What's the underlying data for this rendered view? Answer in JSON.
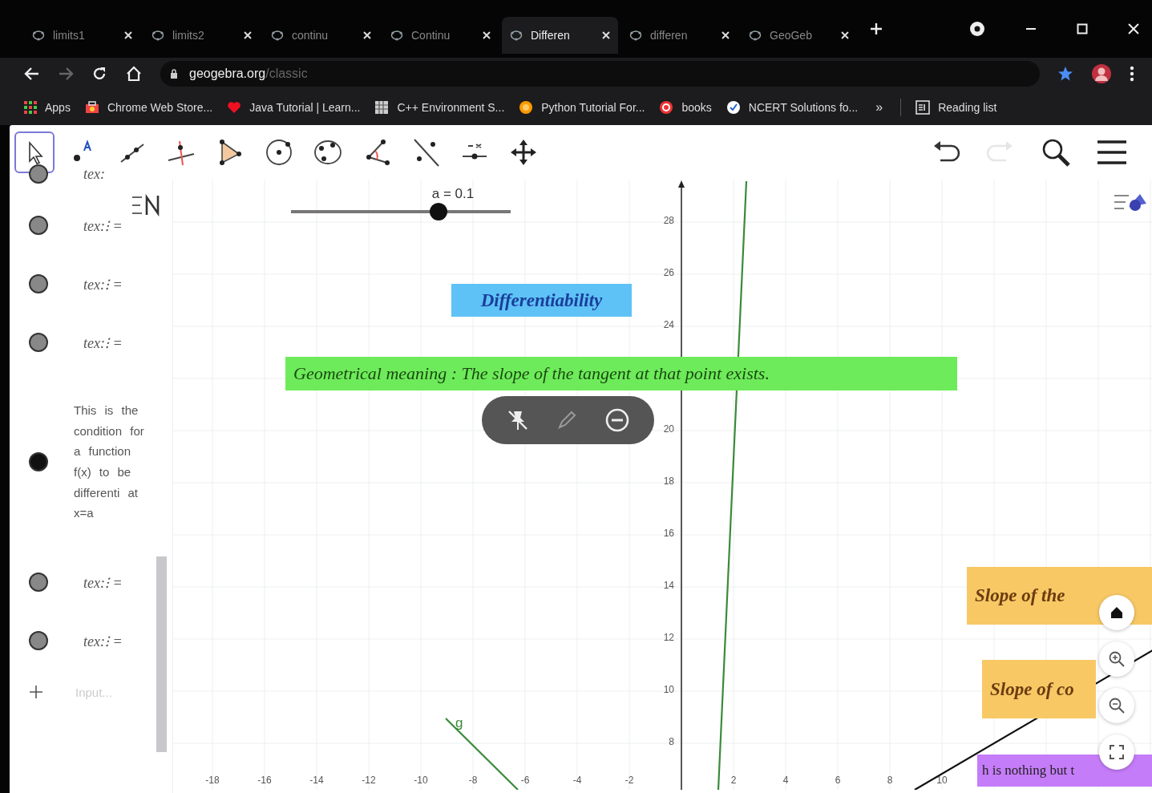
{
  "tabs": [
    {
      "label": "limits1",
      "selected": false
    },
    {
      "label": "limits2",
      "selected": false
    },
    {
      "label": "continu",
      "selected": false
    },
    {
      "label": "Continu",
      "selected": false
    },
    {
      "label": "Differen",
      "selected": true
    },
    {
      "label": "differen",
      "selected": false
    },
    {
      "label": "GeoGeb",
      "selected": false
    }
  ],
  "address": {
    "host": "geogebra.org",
    "path": "/classic"
  },
  "bookmarks": [
    {
      "label": "Apps",
      "kind": "apps"
    },
    {
      "label": "Chrome Web Store...",
      "kind": "store"
    },
    {
      "label": "Java Tutorial | Learn...",
      "kind": "heart"
    },
    {
      "label": "C++ Environment S...",
      "kind": "grid"
    },
    {
      "label": "Python Tutorial For...",
      "kind": "python"
    },
    {
      "label": "books",
      "kind": "ring"
    },
    {
      "label": "NCERT Solutions fo...",
      "kind": "shield"
    }
  ],
  "bookmarks_more": "»",
  "reading_list": "Reading list",
  "tools": [
    {
      "kind": "move",
      "selected": true
    },
    {
      "kind": "point",
      "selected": false
    },
    {
      "kind": "line",
      "selected": false
    },
    {
      "kind": "perpendicular",
      "selected": false
    },
    {
      "kind": "polygon",
      "selected": false
    },
    {
      "kind": "circle",
      "selected": false
    },
    {
      "kind": "ellipse",
      "selected": false
    },
    {
      "kind": "angle",
      "selected": false
    },
    {
      "kind": "reflect",
      "selected": false
    },
    {
      "kind": "slider",
      "selected": false
    },
    {
      "kind": "pan",
      "selected": false
    }
  ],
  "history": [
    {
      "kind": "undo",
      "disabled": false
    },
    {
      "kind": "redo",
      "disabled": true
    }
  ],
  "algebra": {
    "items": [
      {
        "kind": "dot",
        "text": "tex:"
      },
      {
        "kind": "dot",
        "text": "tex:⁝ ="
      },
      {
        "kind": "dot",
        "text": "tex:⁝ ="
      },
      {
        "kind": "dot",
        "text": "tex:⁝ ="
      },
      {
        "kind": "dark-dot",
        "text": "This is the condition for a function f(x) to be differenti at x=a"
      },
      {
        "kind": "dot",
        "text": "tex:⁝ ="
      },
      {
        "kind": "dot",
        "text": "tex:⁝ ="
      }
    ],
    "input_placeholder": "Input..."
  },
  "slider": {
    "label": "a = 0.1",
    "level": 0.67
  },
  "graph": {
    "x_ticks": [
      "-18",
      "-16",
      "-14",
      "-12",
      "-10",
      "-8",
      "-6",
      "-4",
      "-2",
      "2",
      "4",
      "6",
      "8",
      "10"
    ],
    "y_ticks": [
      "28",
      "26",
      "24",
      "20",
      "18",
      "16",
      "14",
      "12",
      "10",
      "8"
    ],
    "curve_label": "g"
  },
  "text_boxes": [
    {
      "kind": "title",
      "text": "Differentiability"
    },
    {
      "kind": "green",
      "text": "Geometrical meaning : The slope of the tangent at that point exists."
    },
    {
      "kind": "yellow",
      "text": "Slope of the"
    },
    {
      "kind": "yellow",
      "text": "Slope of co"
    },
    {
      "kind": "purple",
      "text": "h is nothing but t"
    }
  ]
}
